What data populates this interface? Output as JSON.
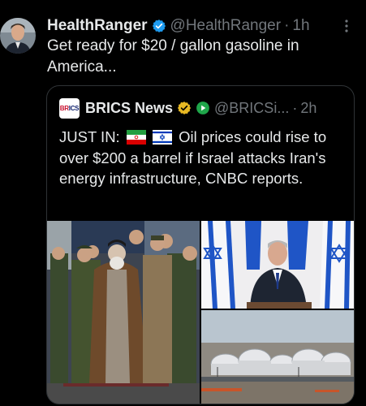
{
  "tweet": {
    "author_name": "HealthRanger",
    "author_handle": "@HealthRanger",
    "separator": "·",
    "time": "1h",
    "text": "Get ready for $20 / gallon gasoline in America..."
  },
  "quote": {
    "logo_text": "BRICS",
    "author_name": "BRICS News",
    "author_handle": "@BRICSi...",
    "separator": "·",
    "time": "2h",
    "text_prefix": "JUST IN:",
    "text_body": "Oil prices could rise to over $200 a barrel if Israel attacks Iran's energy infrastructure, CNBC reports.",
    "flags": [
      "iran-flag",
      "israel-flag"
    ]
  },
  "media": {
    "images": [
      "iran-officials-photo",
      "israel-pm-podium-photo",
      "oil-storage-tanks-photo"
    ]
  },
  "colors": {
    "background": "#000000",
    "text": "#e7e9ea",
    "muted": "#71767b",
    "verified_blue": "#1d9bf0",
    "verified_gold": "#e8b923",
    "border": "#2f3336"
  }
}
